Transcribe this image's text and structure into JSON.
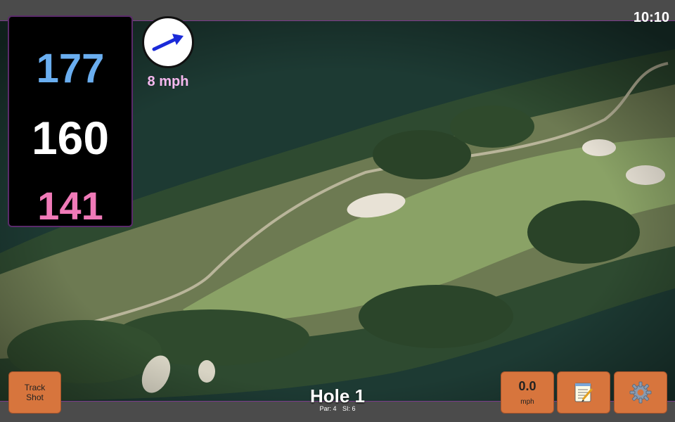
{
  "status": {
    "clock": "10:10"
  },
  "distances": {
    "back": "177",
    "middle": "160",
    "front": "141"
  },
  "wind": {
    "speed": "8 mph",
    "direction_icon": "arrow-northeast-icon"
  },
  "hole": {
    "title": "Hole 1",
    "par_label": "Par: 4",
    "si_label": "SI: 6"
  },
  "buttons": {
    "track_shot_line1": "Track",
    "track_shot_line2": "Shot",
    "speed_value": "0.0",
    "speed_unit": "mph",
    "notes_icon": "notepad-icon",
    "settings_icon": "gear-icon"
  },
  "colors": {
    "back": "#6aaef0",
    "middle": "#ffffff",
    "front": "#f07ab8",
    "wind_text": "#f6b8ef",
    "button": "#d7753d",
    "accent_border": "#7a3a8a"
  }
}
